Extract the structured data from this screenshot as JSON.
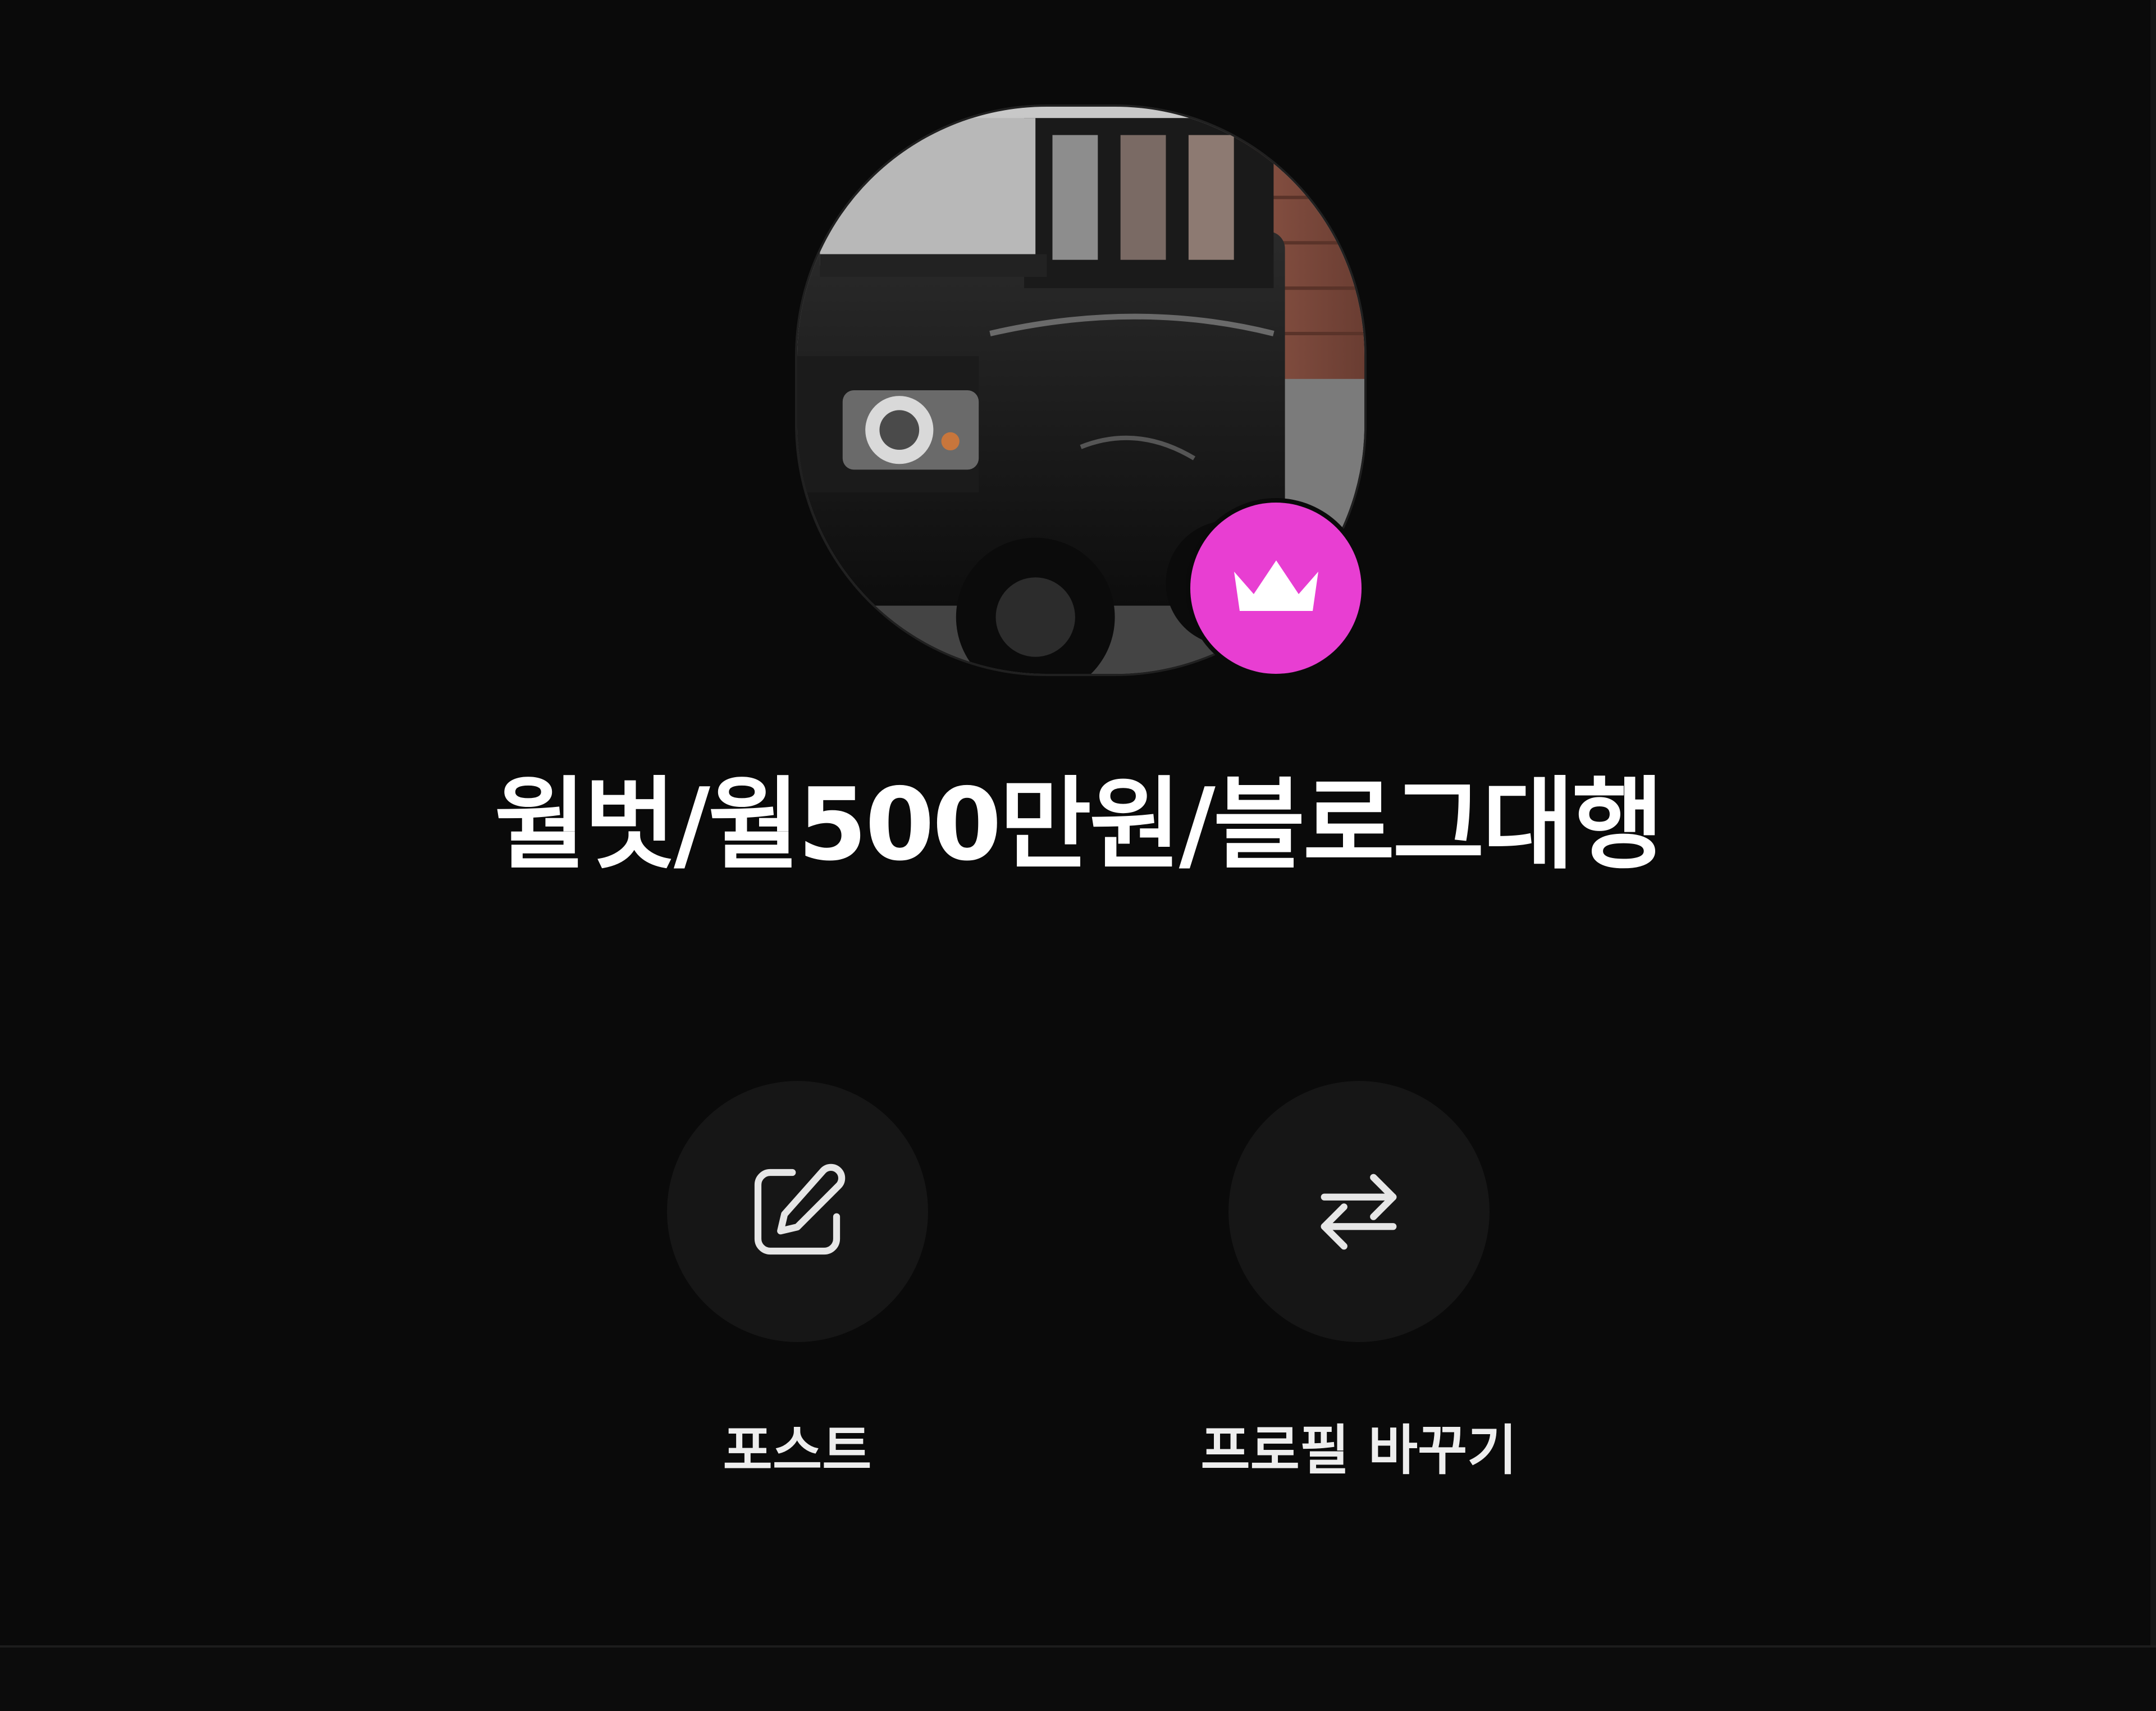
{
  "profile": {
    "name": "월벗/월500만원/블로그대행",
    "image_icon": "profile-car-photo",
    "badge_icon": "crown-icon",
    "badge_color": "#e83ed2"
  },
  "actions": [
    {
      "label": "포스트",
      "icon": "edit-icon"
    },
    {
      "label": "프로필 바꾸기",
      "icon": "swap-arrows-icon"
    }
  ],
  "colors": {
    "background": "#0a0a0a",
    "button_bg": "#161616",
    "text": "#ffffff"
  }
}
